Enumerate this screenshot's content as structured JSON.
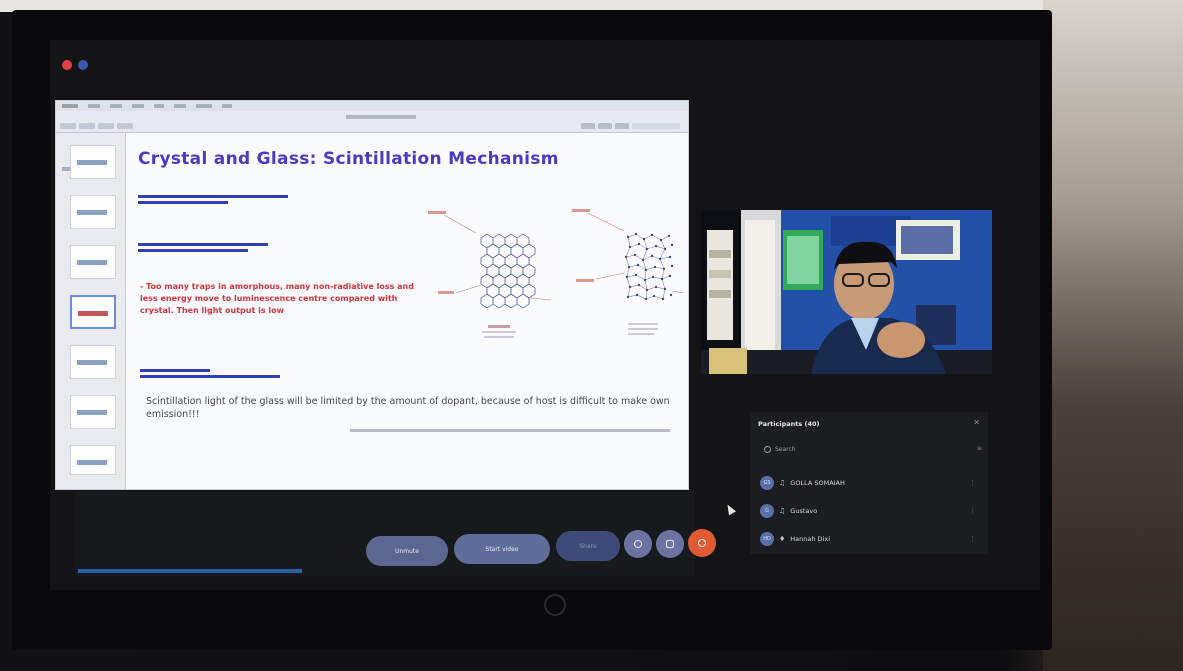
{
  "window": {
    "traffic_lights": [
      "#e0404a",
      "#3a5ab0"
    ]
  },
  "share": {
    "menubar_items": [
      "",
      "",
      "",
      "",
      "",
      "",
      "",
      ""
    ],
    "toolbar_title": "",
    "thumbnail_count": 9
  },
  "slide": {
    "title": "Crystal and Glass: Scintillation Mechanism",
    "red_text": "- Too many traps in amorphous, many non-radiative loss and less energy move to luminescence centre compared with crystal. Then light output is low",
    "body_text": "Scintillation light of the glass will be limited by the amount of dopant, because of host is difficult to make own emission!!!",
    "colors": {
      "title": "#4a3bbf",
      "red_text": "#d2333b",
      "notes": "#1f2fa8"
    }
  },
  "participants": {
    "title": "Participants (40)",
    "search_placeholder": "Search",
    "list": [
      {
        "initials": "GS",
        "name": "GOLLA SOMAIAH"
      },
      {
        "initials": "G",
        "name": "Gustavo"
      },
      {
        "initials": "HD",
        "name": "Hannah Dixi"
      }
    ]
  },
  "controls": {
    "unmute_label": "Unmute",
    "video_label": "Start video",
    "share_label": "Share",
    "leave_color": "#e05a34"
  }
}
